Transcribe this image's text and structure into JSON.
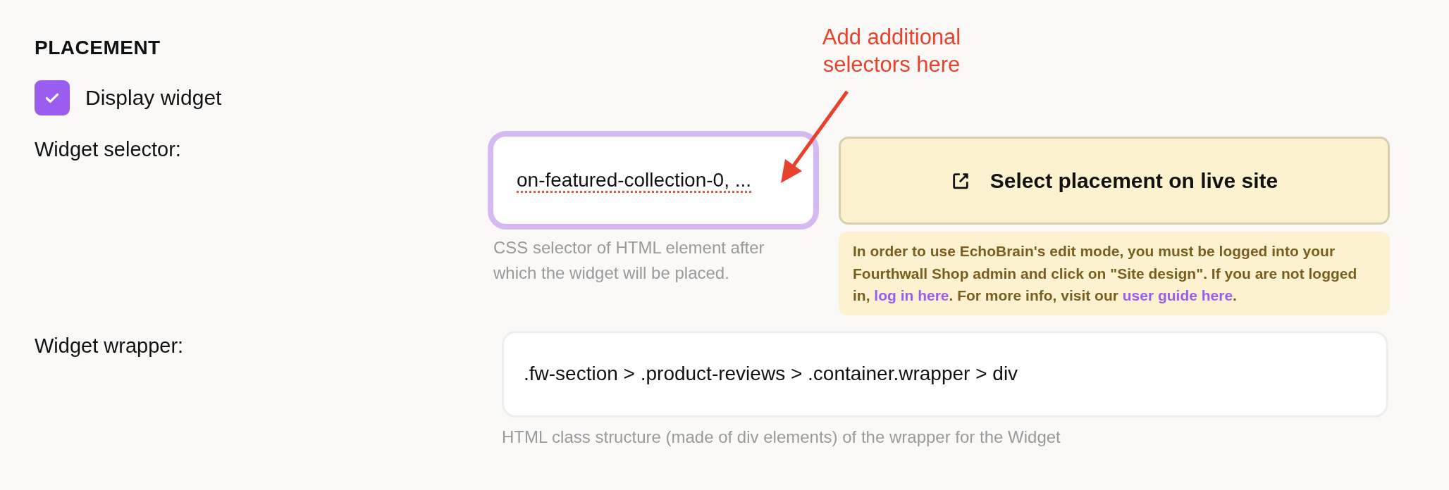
{
  "section": {
    "title": "PLACEMENT"
  },
  "display_widget": {
    "label": "Display widget",
    "checked": true
  },
  "widget_selector": {
    "label": "Widget selector:",
    "value": "on-featured-collection-0, ...",
    "focused": true,
    "spellcheck_error": true,
    "hint": "CSS selector of HTML element after which the widget will be placed."
  },
  "select_button": {
    "label": "Select placement on live site"
  },
  "notice": {
    "segments": [
      {
        "kind": "text",
        "text": "In order to use EchoBrain's edit mode, you must be logged into your Fourthwall Shop admin and click on \"Site design\". If you are not logged in, "
      },
      {
        "kind": "link",
        "text": "log in here"
      },
      {
        "kind": "text",
        "text": ". For more info, visit our "
      },
      {
        "kind": "link",
        "text": "user guide here"
      },
      {
        "kind": "text",
        "text": "."
      }
    ]
  },
  "widget_wrapper": {
    "label": "Widget wrapper:",
    "value": ".fw-section > .product-reviews > .container.wrapper > div",
    "focused": false,
    "hint": "HTML class structure (made of div elements) of the wrapper for the Widget"
  },
  "annotation": {
    "text": "Add additional selectors here"
  }
}
